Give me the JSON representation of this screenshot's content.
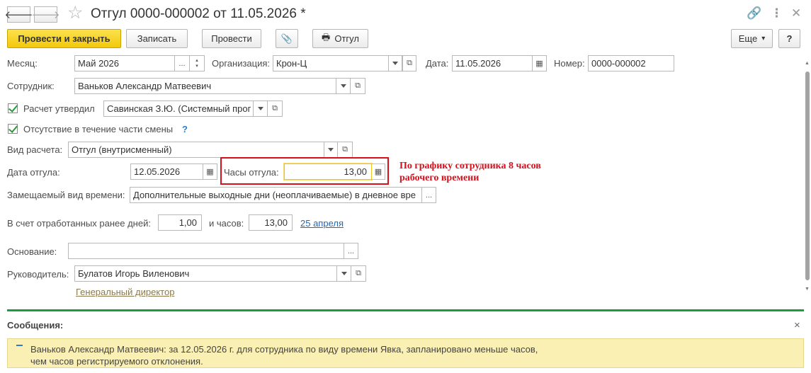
{
  "window": {
    "title": "Отгул 0000-000002 от 11.05.2026 *",
    "back_glyph": "🡐",
    "forward_glyph": "🡒",
    "star_glyph": "☆",
    "link_glyph": "🔗",
    "more_glyph": "⋮",
    "close_glyph": "✕"
  },
  "toolbar": {
    "post_close_label": "Провести и закрыть",
    "save_label": "Записать",
    "post_label": "Провести",
    "attach_glyph": "📎",
    "print_glyph": "🖶",
    "print_label": "Отгул",
    "more_label": "Еще",
    "more_arrow": "▾",
    "help_label": "?"
  },
  "form": {
    "month_label": "Месяц:",
    "month_value": "Май 2026",
    "ellipsis": "...",
    "org_label": "Организация:",
    "org_value": "Крон-Ц",
    "date_label": "Дата:",
    "date_value": "11.05.2026",
    "number_label": "Номер:",
    "number_value": "0000-000002",
    "employee_label": "Сотрудник:",
    "employee_value": "Ваньков Александр Матвеевич",
    "approved_label": "Расчет утвердил",
    "approved_value": "Савинская З.Ю. (Системный прог",
    "partial_shift_label": "Отсутствие в течение части смены",
    "partial_shift_help": "?",
    "calc_type_label": "Вид расчета:",
    "calc_type_value": "Отгул (внутрисменный)",
    "leave_date_label": "Дата отгула:",
    "leave_date_value": "12.05.2026",
    "leave_hours_label": "Часы отгула:",
    "leave_hours_value": "13,00",
    "replaced_label": "Замещаемый вид времени:",
    "replaced_value": "Дополнительные выходные дни (неоплачиваемые) в дневное вре",
    "worked_days_label": "В счет отработанных ранее дней:",
    "worked_days_value": "1,00",
    "worked_hours_label": "и часов:",
    "worked_hours_value": "13,00",
    "worked_date_link": "25 апреля",
    "basis_label": "Основание:",
    "basis_value": "",
    "manager_label": "Руководитель:",
    "manager_value": "Булатов Игорь Виленович",
    "manager_position": "Генеральный директор"
  },
  "annotation": {
    "line1": "По графику сотрудника 8 часов",
    "line2": "рабочего времени"
  },
  "messages": {
    "header": "Сообщения:",
    "close_glyph": "×",
    "line1": "Ваньков Александр Матвеевич: за 12.05.2026 г. для сотрудника по виду времени Явка, запланировано меньше часов,",
    "line2": "чем часов регистрируемого отклонения."
  },
  "colors": {
    "primary_button": "#f5ce1c",
    "annotation": "#d8101c",
    "message_background": "#fbf0b3",
    "separator": "#1f9a3c",
    "link": "#2666b3"
  }
}
